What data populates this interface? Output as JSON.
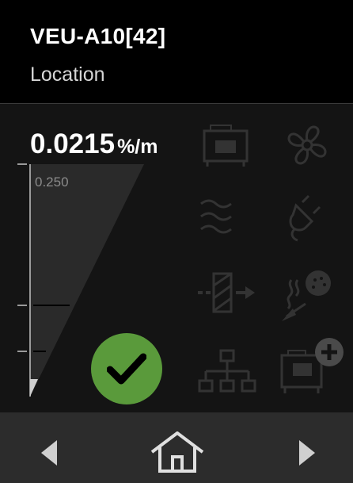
{
  "header": {
    "device_id": "VEU-A10[42]",
    "location": "Location"
  },
  "reading": {
    "value": "0.0215",
    "unit": "%/m"
  },
  "scale": {
    "top_label": "0.250"
  },
  "status": {
    "state": "ok",
    "color": "#5a9a3b"
  },
  "icons": [
    "device-card-icon",
    "fan-icon",
    "airflow-icon",
    "power-plug-icon",
    "filter-icon",
    "smoke-detector-icon",
    "network-icon",
    "add-device-icon"
  ],
  "footer": {
    "left": "chevron-left-icon",
    "center": "home-icon",
    "right": "chevron-right-icon"
  }
}
